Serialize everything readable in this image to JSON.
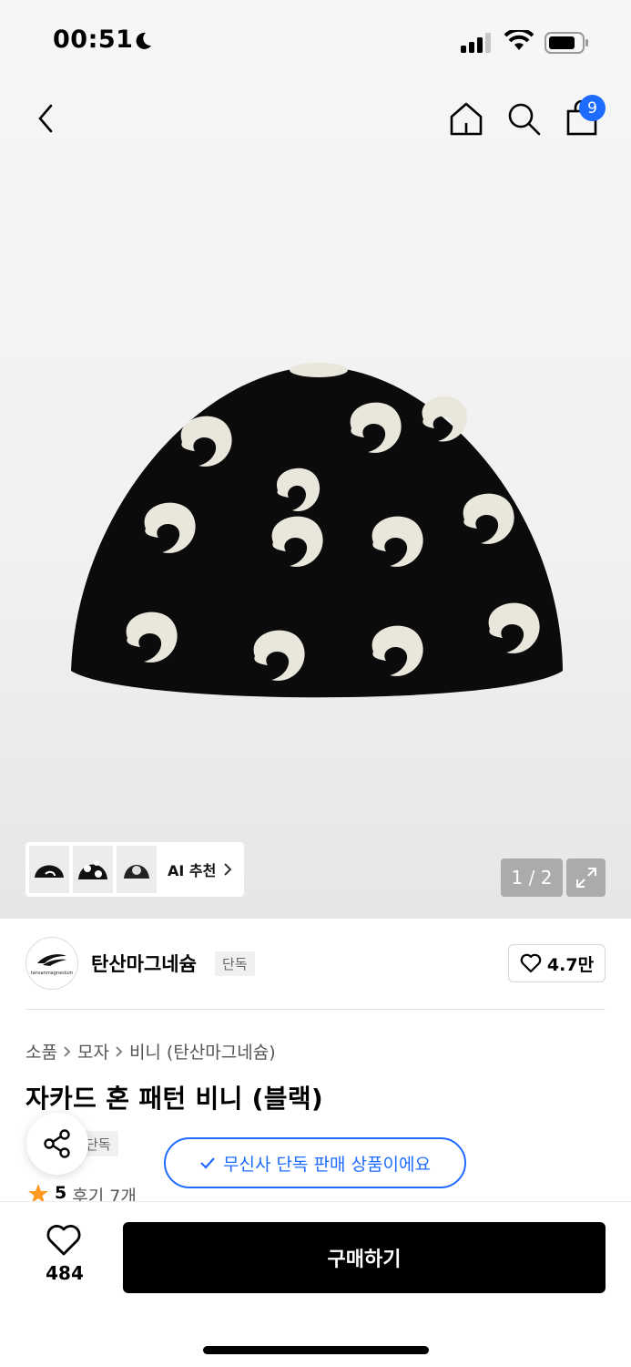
{
  "status_bar": {
    "time": "00:51"
  },
  "header": {
    "cart_count": "9"
  },
  "gallery": {
    "ai_recommend_label": "AI 추천",
    "page_indicator": "1 / 2"
  },
  "brand": {
    "name": "탄산마그네슘",
    "tag": "단독",
    "logo_text": "tansanmagnesium",
    "like_count": "4.7만"
  },
  "breadcrumb": [
    "소품",
    "모자",
    "비니 (탄산마그네슘)"
  ],
  "product": {
    "title": "자카드 혼 패턴 비니 (블랙)",
    "exclusive_tag": "단독",
    "exclusive_notice": "무신사 단독 판매 상품이에요",
    "rating": "5",
    "review_text": "후기 7개"
  },
  "bottom_bar": {
    "wish_count": "484",
    "buy_label": "구매하기"
  }
}
